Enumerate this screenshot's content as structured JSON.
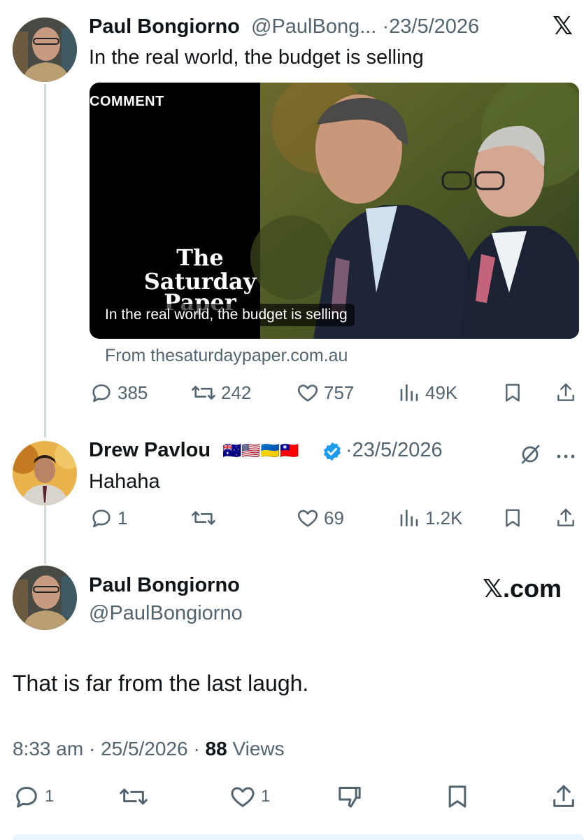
{
  "tweet1": {
    "author_name": "Paul Bongiorno",
    "handle_truncated": "@PaulBong...",
    "separator": "·",
    "date": "23/5/2026",
    "text": "In the real world, the budget is selling",
    "card": {
      "tag": "COMMENT",
      "logo_line1": "The",
      "logo_line2": "Saturday",
      "logo_line3": "Paper",
      "caption": "In the real world, the budget is selling",
      "source": "From thesaturdaypaper.com.au"
    },
    "actions": {
      "replies": "385",
      "reposts": "242",
      "likes": "757",
      "views": "49K"
    }
  },
  "tweet2": {
    "author_name": "Drew Pavlou",
    "flags": "🇦🇺🇺🇸🇺🇦🇹🇼",
    "separator": "·",
    "date": "23/5/2026",
    "text": "Hahaha",
    "actions": {
      "replies": "1",
      "reposts": "",
      "likes": "69",
      "views": "1.2K"
    }
  },
  "main_tweet": {
    "author_name": "Paul Bongiorno",
    "handle": "@PaulBongiorno",
    "brand": "𝕏.com",
    "text": "That is far from the last laugh.",
    "time": "8:33 am",
    "date": "25/5/2026",
    "separator": "·",
    "views_count": "88",
    "views_label": "Views",
    "actions": {
      "replies": "1",
      "likes": "1"
    }
  },
  "top_logo": "𝕏",
  "colors": {
    "accent": "#1d9bf0",
    "text": "#0f1419",
    "secondary": "#536471",
    "line": "#cfd9de"
  }
}
